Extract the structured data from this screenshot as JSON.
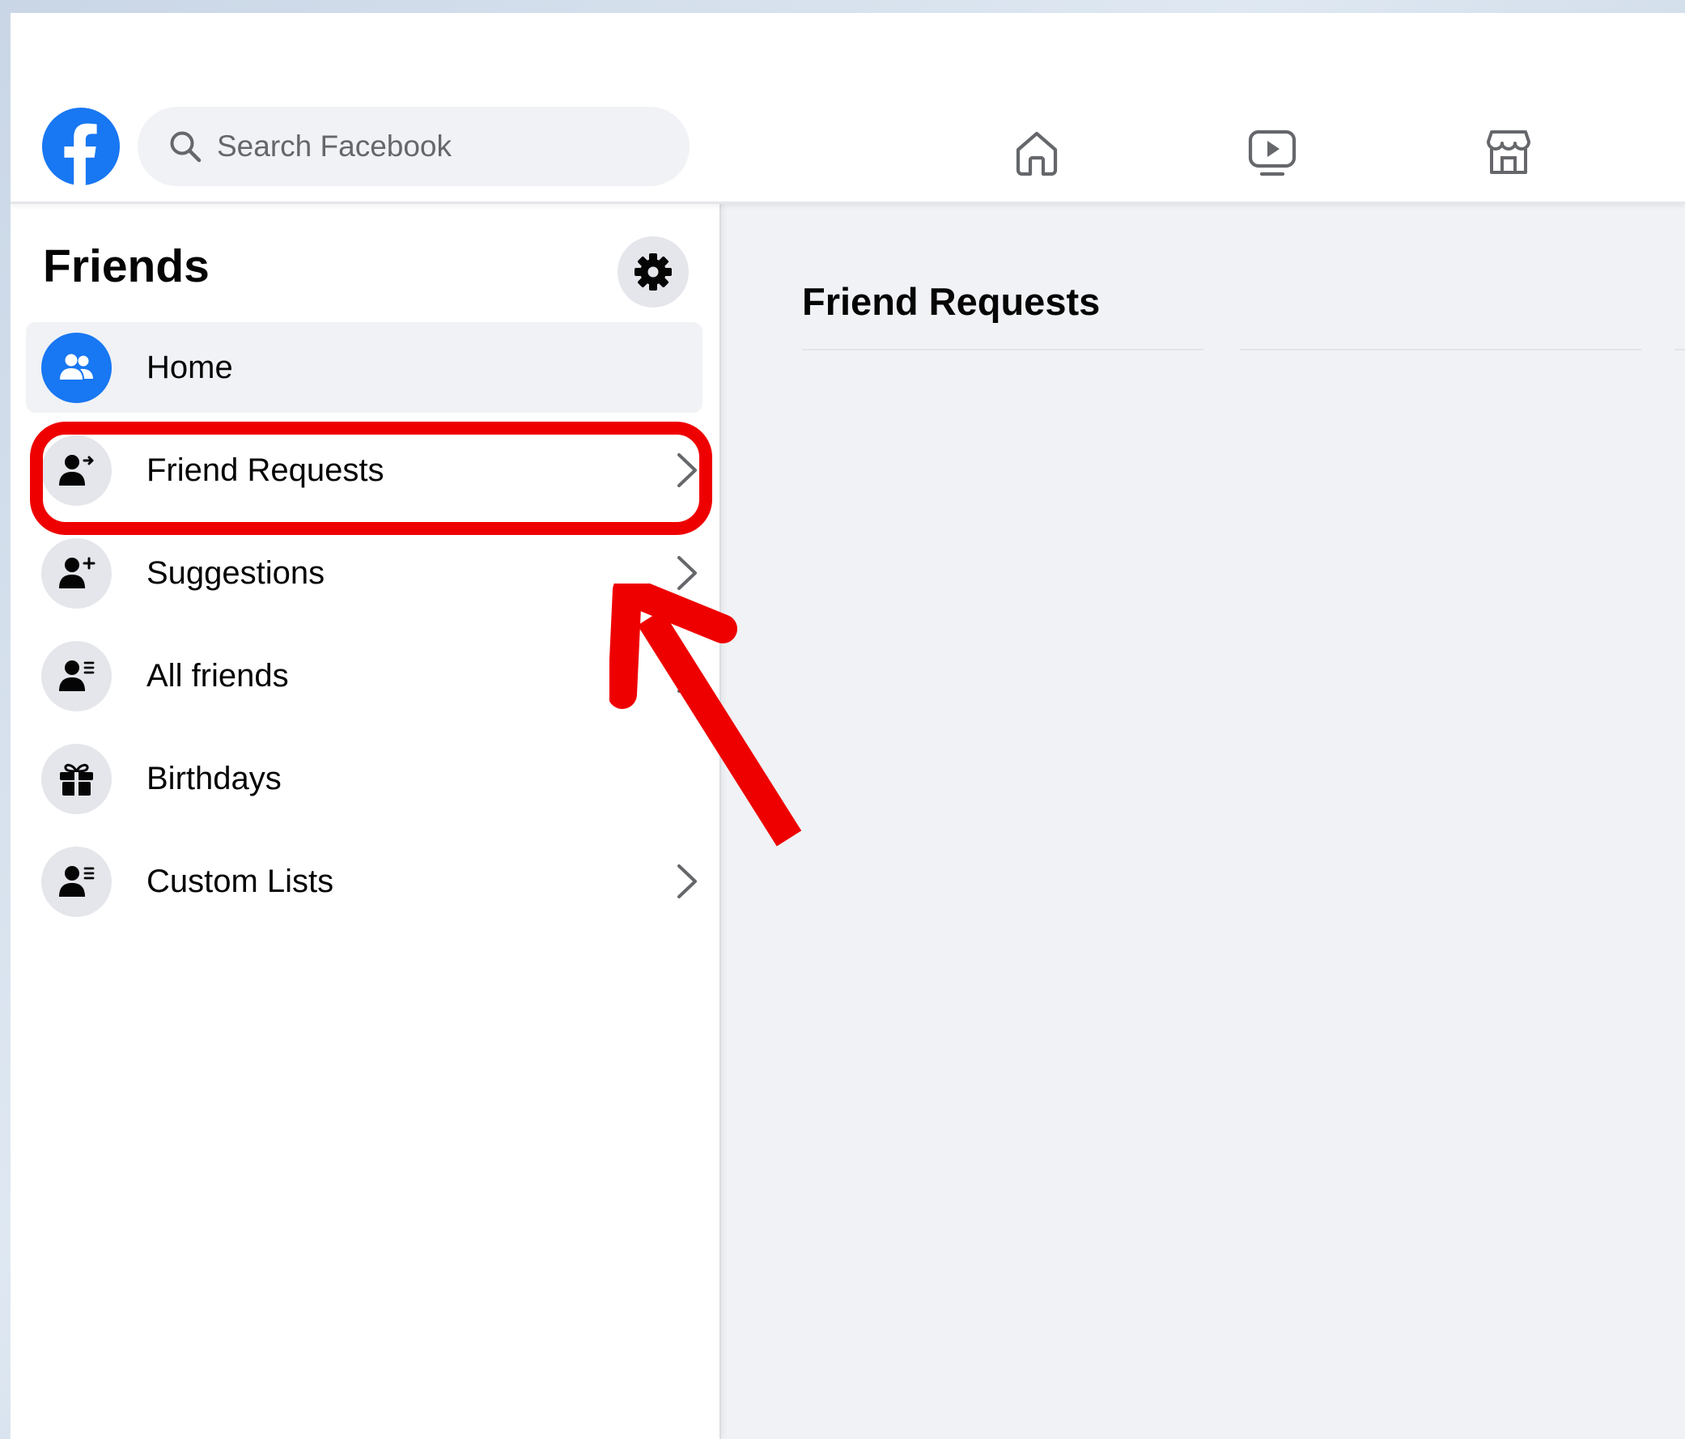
{
  "header": {
    "search": {
      "placeholder": "Search Facebook",
      "value": ""
    },
    "nav_icons": [
      "home-icon",
      "watch-icon",
      "marketplace-icon"
    ]
  },
  "sidebar": {
    "title": "Friends",
    "items": [
      {
        "label": "Home",
        "icon": "friends-home-icon",
        "active": true,
        "has_chevron": false
      },
      {
        "label": "Friend Requests",
        "icon": "friend-request-icon",
        "active": false,
        "has_chevron": true,
        "highlighted": true
      },
      {
        "label": "Suggestions",
        "icon": "suggestions-icon",
        "active": false,
        "has_chevron": true
      },
      {
        "label": "All friends",
        "icon": "all-friends-icon",
        "active": false,
        "has_chevron": true
      },
      {
        "label": "Birthdays",
        "icon": "gift-icon",
        "active": false,
        "has_chevron": false
      },
      {
        "label": "Custom Lists",
        "icon": "custom-lists-icon",
        "active": false,
        "has_chevron": true
      }
    ]
  },
  "main": {
    "title": "Friend Requests"
  },
  "colors": {
    "brand": "#1877f2",
    "annotation": "#ef0000",
    "background": "#f0f2f5",
    "icon_circle": "#e4e6eb"
  }
}
